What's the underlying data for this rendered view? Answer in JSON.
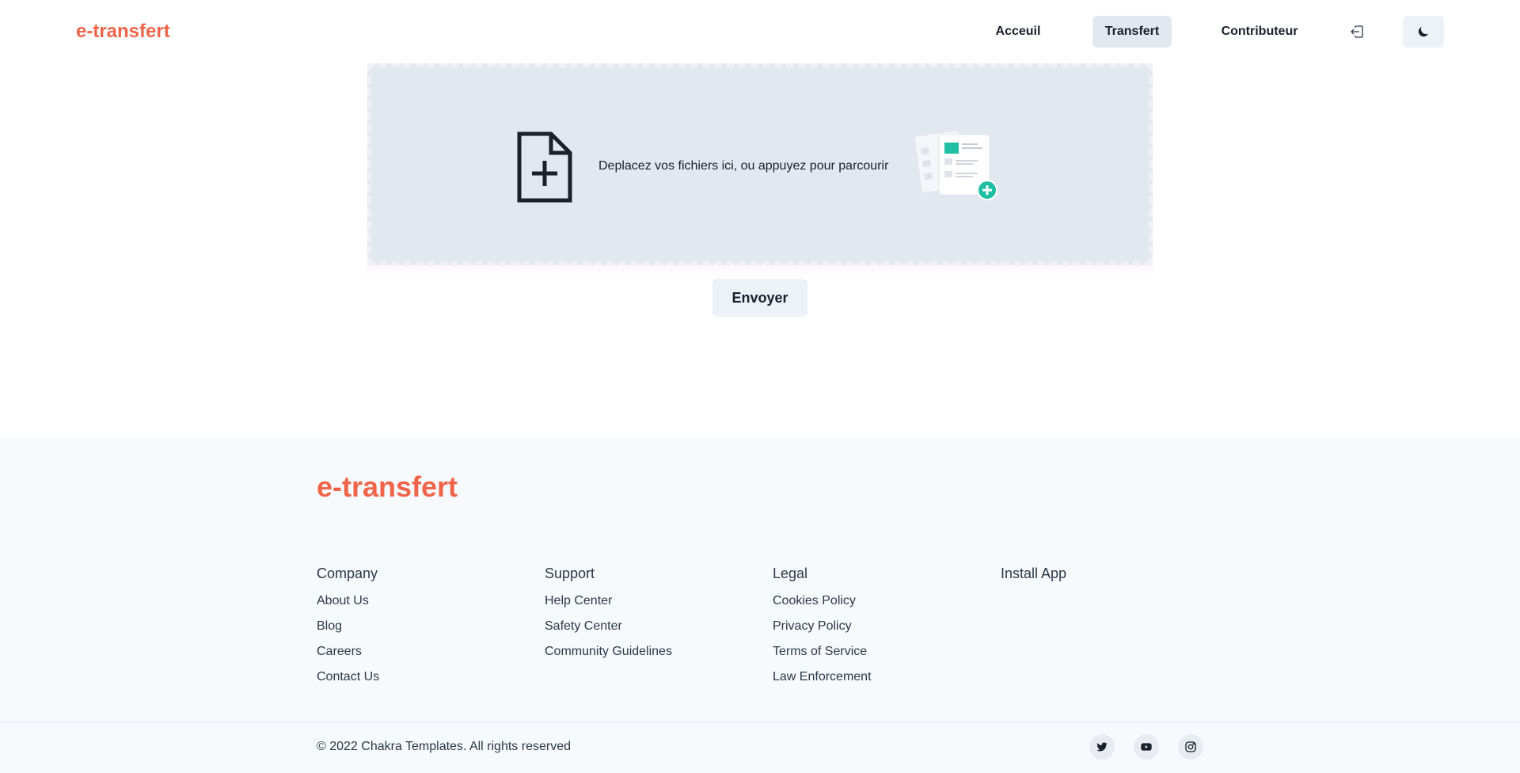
{
  "header": {
    "brand": "e-transfert",
    "nav": {
      "acceuil": "Acceuil",
      "transfert": "Transfert",
      "contributeur": "Contributeur"
    },
    "icons": {
      "login": "login-icon",
      "theme": "moon-icon"
    }
  },
  "dropzone": {
    "text": "Deplacez vos fichiers ici, ou appuyez pour parcourir",
    "icon": "file-plus-icon",
    "illustration": "documents-add-illustration"
  },
  "send_button": "Envoyer",
  "footer": {
    "brand": "e-transfert",
    "columns": [
      {
        "title": "Company",
        "links": [
          "About Us",
          "Blog",
          "Careers",
          "Contact Us"
        ]
      },
      {
        "title": "Support",
        "links": [
          "Help Center",
          "Safety Center",
          "Community Guidelines"
        ]
      },
      {
        "title": "Legal",
        "links": [
          "Cookies Policy",
          "Privacy Policy",
          "Terms of Service",
          "Law Enforcement"
        ]
      },
      {
        "title": "Install App",
        "links": []
      }
    ],
    "copyright": "© 2022 Chakra Templates. All rights reserved",
    "social": [
      "twitter-icon",
      "youtube-icon",
      "instagram-icon"
    ]
  },
  "colors": {
    "brand": "#f0644a",
    "active_nav_bg": "#e2e8f0",
    "dropzone_bg": "#e2e8f0",
    "footer_bg": "#f7fafc",
    "accent": "#1fbfa4"
  }
}
